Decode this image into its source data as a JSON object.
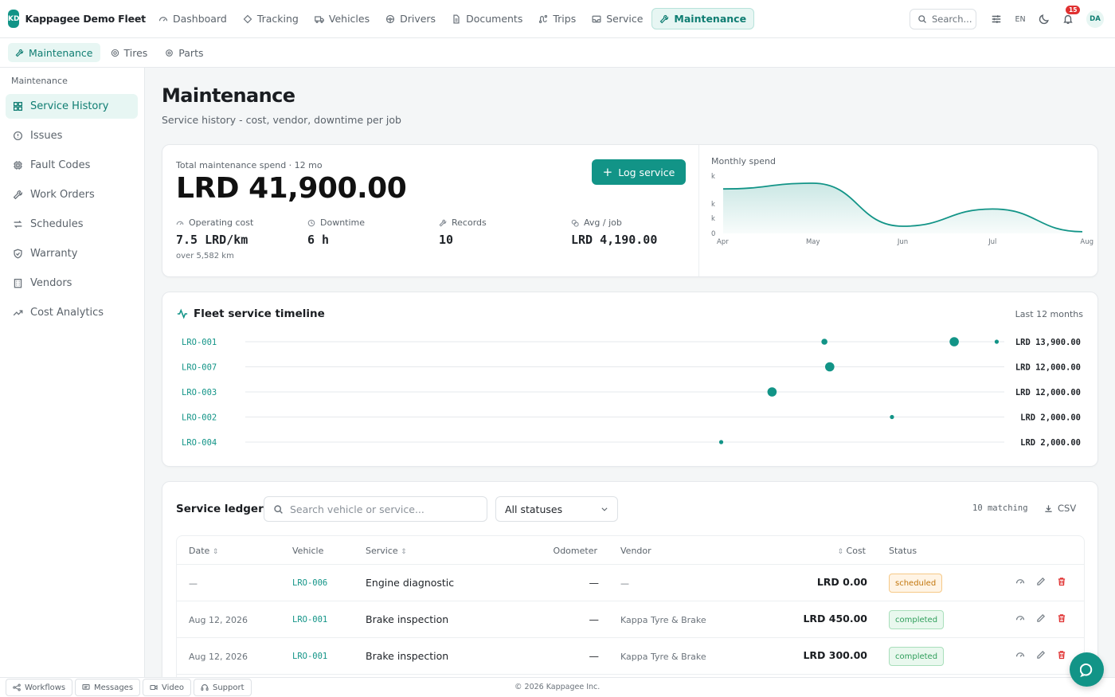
{
  "brand": {
    "logo_text": "KD",
    "name": "Kappagee Demo Fleet"
  },
  "nav": [
    {
      "label": "Dashboard",
      "icon": "gauge-icon"
    },
    {
      "label": "Tracking",
      "icon": "location-icon"
    },
    {
      "label": "Vehicles",
      "icon": "truck-icon"
    },
    {
      "label": "Drivers",
      "icon": "steering-wheel-icon"
    },
    {
      "label": "Documents",
      "icon": "document-icon"
    },
    {
      "label": "Trips",
      "icon": "route-icon"
    },
    {
      "label": "Service",
      "icon": "inbox-icon"
    },
    {
      "label": "Maintenance",
      "icon": "wrench-icon",
      "active": true
    }
  ],
  "topbar": {
    "search_label": "Search...",
    "lang": "EN",
    "notif_count": "15",
    "avatar": "DA"
  },
  "subnav": [
    {
      "label": "Maintenance",
      "active": true
    },
    {
      "label": "Tires"
    },
    {
      "label": "Parts"
    }
  ],
  "sidebar": {
    "heading": "Maintenance",
    "items": [
      {
        "label": "Service History",
        "icon": "grid-icon",
        "active": true
      },
      {
        "label": "Issues",
        "icon": "alert-circle-icon"
      },
      {
        "label": "Fault Codes",
        "icon": "chip-icon"
      },
      {
        "label": "Work Orders",
        "icon": "wrench-icon"
      },
      {
        "label": "Schedules",
        "icon": "repeat-icon"
      },
      {
        "label": "Warranty",
        "icon": "shield-icon"
      },
      {
        "label": "Vendors",
        "icon": "building-icon"
      },
      {
        "label": "Cost Analytics",
        "icon": "trend-icon"
      }
    ]
  },
  "page": {
    "title": "Maintenance",
    "subtitle": "Service history - cost, vendor, downtime per job"
  },
  "kpi": {
    "label": "Total maintenance spend · 12 mo",
    "value": "LRD 41,900.00",
    "log_button": "Log service",
    "stats": [
      {
        "label": "Operating cost",
        "value": "7.5 LRD/km",
        "note": "over 5,582 km",
        "icon": "gauge-icon"
      },
      {
        "label": "Downtime",
        "value": "6 h",
        "icon": "clock-icon"
      },
      {
        "label": "Records",
        "value": "10",
        "icon": "wrench-icon"
      },
      {
        "label": "Avg / job",
        "value": "LRD 4,190.00",
        "icon": "coins-icon"
      }
    ]
  },
  "chart_data": {
    "type": "area",
    "title": "Monthly spend",
    "categories": [
      "Apr",
      "May",
      "Jun",
      "Jul",
      "Aug"
    ],
    "values": [
      15500,
      17500,
      2500,
      8500,
      600
    ],
    "y_tick_labels": [
      "k",
      "k",
      "k",
      "0"
    ],
    "color": "#129487",
    "grid": false
  },
  "timeline": {
    "title": "Fleet service timeline",
    "range_label": "Last 12 months",
    "rows": [
      {
        "vehicle": "LRO-001",
        "total": "LRD 13,900.00",
        "events": [
          {
            "pos": 0.763,
            "size": 1
          },
          {
            "pos": 0.934,
            "size": 2
          },
          {
            "pos": 0.99,
            "size": 0
          }
        ]
      },
      {
        "vehicle": "LRO-007",
        "total": "LRD 12,000.00",
        "events": [
          {
            "pos": 0.77,
            "size": 2
          }
        ]
      },
      {
        "vehicle": "LRO-003",
        "total": "LRD 12,000.00",
        "events": [
          {
            "pos": 0.694,
            "size": 2
          }
        ]
      },
      {
        "vehicle": "LRO-002",
        "total": "LRD 2,000.00",
        "events": [
          {
            "pos": 0.852,
            "size": 0
          }
        ]
      },
      {
        "vehicle": "LRO-004",
        "total": "LRD 2,000.00",
        "events": [
          {
            "pos": 0.627,
            "size": 0
          }
        ]
      }
    ]
  },
  "ledger": {
    "title": "Service ledger",
    "search_placeholder": "Search vehicle or service...",
    "status_filter": "All statuses",
    "matching": "10 matching",
    "csv_label": "CSV",
    "columns": {
      "date": "Date",
      "vehicle": "Vehicle",
      "service": "Service",
      "odometer": "Odometer",
      "vendor": "Vendor",
      "cost": "Cost",
      "status": "Status"
    },
    "rows": [
      {
        "date": "—",
        "vehicle": "LRO-006",
        "service": "Engine diagnostic",
        "odometer": "—",
        "vendor": "—",
        "cost": "LRD 0.00",
        "status": "scheduled"
      },
      {
        "date": "Aug 12, 2026",
        "vehicle": "LRO-001",
        "service": "Brake inspection",
        "odometer": "—",
        "vendor": "Kappa Tyre & Brake",
        "cost": "LRD 450.00",
        "status": "completed"
      },
      {
        "date": "Aug 12, 2026",
        "vehicle": "LRO-001",
        "service": "Brake inspection",
        "odometer": "—",
        "vendor": "Kappa Tyre & Brake",
        "cost": "LRD 300.00",
        "status": "completed"
      }
    ]
  },
  "footer": {
    "buttons": [
      "Workflows",
      "Messages",
      "Video",
      "Support"
    ],
    "copyright": "© 2026 Kappagee Inc."
  },
  "colors": {
    "accent": "#129487",
    "accent_soft": "#e7f6f3",
    "danger": "#e03131",
    "warning": "#c2760c",
    "success": "#2f9e5b"
  }
}
